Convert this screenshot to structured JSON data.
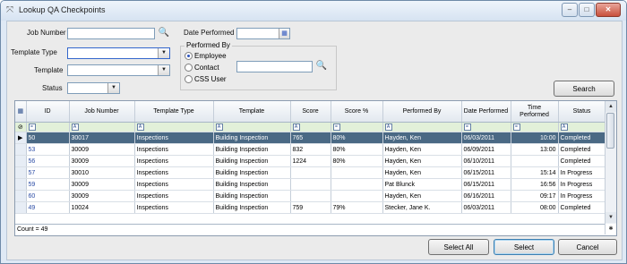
{
  "window": {
    "title": "Lookup QA Checkpoints",
    "icon": "pin-icon",
    "controls": [
      "minimize-icon",
      "maximize-icon",
      "close-icon"
    ]
  },
  "form": {
    "job_number_label": "Job Number",
    "job_number_value": "",
    "template_type_label": "Template Type",
    "template_type_value": "",
    "template_label": "Template",
    "template_value": "",
    "status_label": "Status",
    "status_value": "",
    "date_performed_label": "Date Performed",
    "date_performed_value": "",
    "performed_by": {
      "label": "Performed By",
      "options": [
        "Employee",
        "Contact",
        "CSS User"
      ],
      "selected": "Employee",
      "search_value": ""
    },
    "search_button": "Search"
  },
  "grid": {
    "columns": [
      "ID",
      "Job Number",
      "Template Type",
      "Template",
      "Score",
      "Score %",
      "Performed By",
      "Date Performed",
      "Time Performed",
      "Status"
    ],
    "filter_ops": [
      "=",
      "A",
      "A",
      "A",
      "A",
      "=",
      "A",
      "=",
      "=",
      "A"
    ],
    "rows": [
      {
        "id": "50",
        "job": "30017",
        "type": "Inspections",
        "template": "Building Inspection",
        "score": "765",
        "pct": "80%",
        "by": "Hayden, Ken",
        "date": "06/03/2011",
        "time": "10:00",
        "status": "Completed",
        "current": true
      },
      {
        "id": "53",
        "job": "30009",
        "type": "Inspections",
        "template": "Building Inspection",
        "score": "832",
        "pct": "80%",
        "by": "Hayden, Ken",
        "date": "06/09/2011",
        "time": "13:00",
        "status": "Completed",
        "current": false
      },
      {
        "id": "56",
        "job": "30009",
        "type": "Inspections",
        "template": "Building Inspection",
        "score": "1224",
        "pct": "80%",
        "by": "Hayden, Ken",
        "date": "06/10/2011",
        "time": "",
        "status": "Completed",
        "current": false
      },
      {
        "id": "57",
        "job": "30010",
        "type": "Inspections",
        "template": "Building Inspection",
        "score": "",
        "pct": "",
        "by": "Hayden, Ken",
        "date": "06/15/2011",
        "time": "15:14",
        "status": "In Progress",
        "current": false
      },
      {
        "id": "59",
        "job": "30009",
        "type": "Inspections",
        "template": "Building Inspection",
        "score": "",
        "pct": "",
        "by": "Pat Blunck",
        "date": "06/15/2011",
        "time": "16:56",
        "status": "In Progress",
        "current": false
      },
      {
        "id": "60",
        "job": "30009",
        "type": "Inspections",
        "template": "Building Inspection",
        "score": "",
        "pct": "",
        "by": "Hayden, Ken",
        "date": "06/16/2011",
        "time": "09:17",
        "status": "In Progress",
        "current": false
      },
      {
        "id": "49",
        "job": "10024",
        "type": "Inspections",
        "template": "Building Inspection",
        "score": "759",
        "pct": "79%",
        "by": "Stecker, Jane    K.",
        "date": "06/03/2011",
        "time": "08:00",
        "status": "Completed",
        "current": false
      }
    ],
    "count": "Count = 49"
  },
  "footer": {
    "select_all": "Select All",
    "select": "Select",
    "cancel": "Cancel"
  }
}
